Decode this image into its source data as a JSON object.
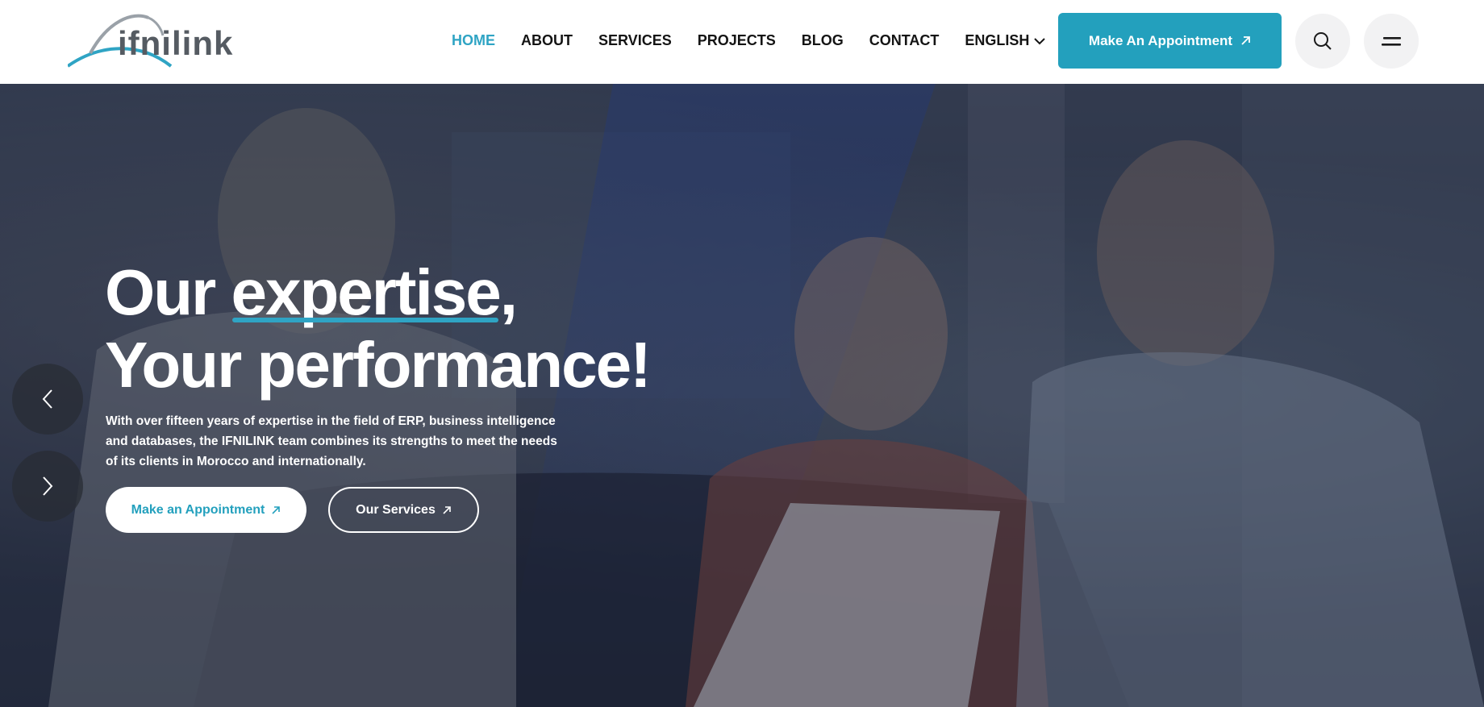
{
  "brand": {
    "logo_text": "ifnilink",
    "accent_color": "#23a0bd"
  },
  "nav": {
    "items": [
      {
        "label": "HOME",
        "active": true
      },
      {
        "label": "ABOUT"
      },
      {
        "label": "SERVICES"
      },
      {
        "label": "PROJECTS"
      },
      {
        "label": "BLOG"
      },
      {
        "label": "CONTACT"
      },
      {
        "label": "ENGLISH",
        "icon": "chevron-down-icon"
      }
    ]
  },
  "header": {
    "cta_label": "Make An Appointment",
    "cta_icon": "arrow-up-right-icon",
    "search_icon": "search-icon",
    "menu_icon": "menu-icon"
  },
  "hero": {
    "title_part1": "Our ",
    "title_highlight": "expertise",
    "title_part2": ",",
    "title_line2": "Your performance!",
    "description": "With over fifteen years of expertise in the field of ERP, business intelligence and databases, the IFNILINK team combines its strengths to meet the needs of its clients in Morocco and internationally.",
    "primary_button": "Make an Appointment",
    "secondary_button": "Our Services",
    "prev_icon": "chevron-left-icon",
    "next_icon": "chevron-right-icon"
  }
}
